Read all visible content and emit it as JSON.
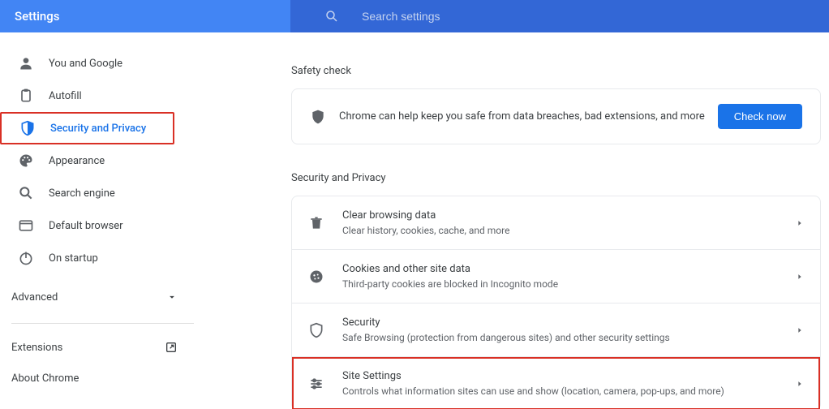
{
  "header": {
    "title": "Settings",
    "search_placeholder": "Search settings"
  },
  "sidebar": {
    "items": [
      {
        "icon": "person",
        "label": "You and Google"
      },
      {
        "icon": "clipboard",
        "label": "Autofill"
      },
      {
        "icon": "shield",
        "label": "Security and Privacy",
        "active": true
      },
      {
        "icon": "palette",
        "label": "Appearance"
      },
      {
        "icon": "search",
        "label": "Search engine"
      },
      {
        "icon": "browser",
        "label": "Default browser"
      },
      {
        "icon": "power",
        "label": "On startup"
      }
    ],
    "advanced": "Advanced",
    "extensions": "Extensions",
    "about": "About Chrome"
  },
  "main": {
    "safety": {
      "title": "Safety check",
      "text": "Chrome can help keep you safe from data breaches, bad extensions, and more",
      "button": "Check now"
    },
    "privacy": {
      "title": "Security and Privacy",
      "items": [
        {
          "icon": "trash",
          "title": "Clear browsing data",
          "desc": "Clear history, cookies, cache, and more"
        },
        {
          "icon": "cookie",
          "title": "Cookies and other site data",
          "desc": "Third-party cookies are blocked in Incognito mode"
        },
        {
          "icon": "shield-outline",
          "title": "Security",
          "desc": "Safe Browsing (protection from dangerous sites) and other security settings"
        },
        {
          "icon": "tune",
          "title": "Site Settings",
          "desc": "Controls what information sites can use and show (location, camera, pop-ups, and more)"
        }
      ]
    }
  }
}
